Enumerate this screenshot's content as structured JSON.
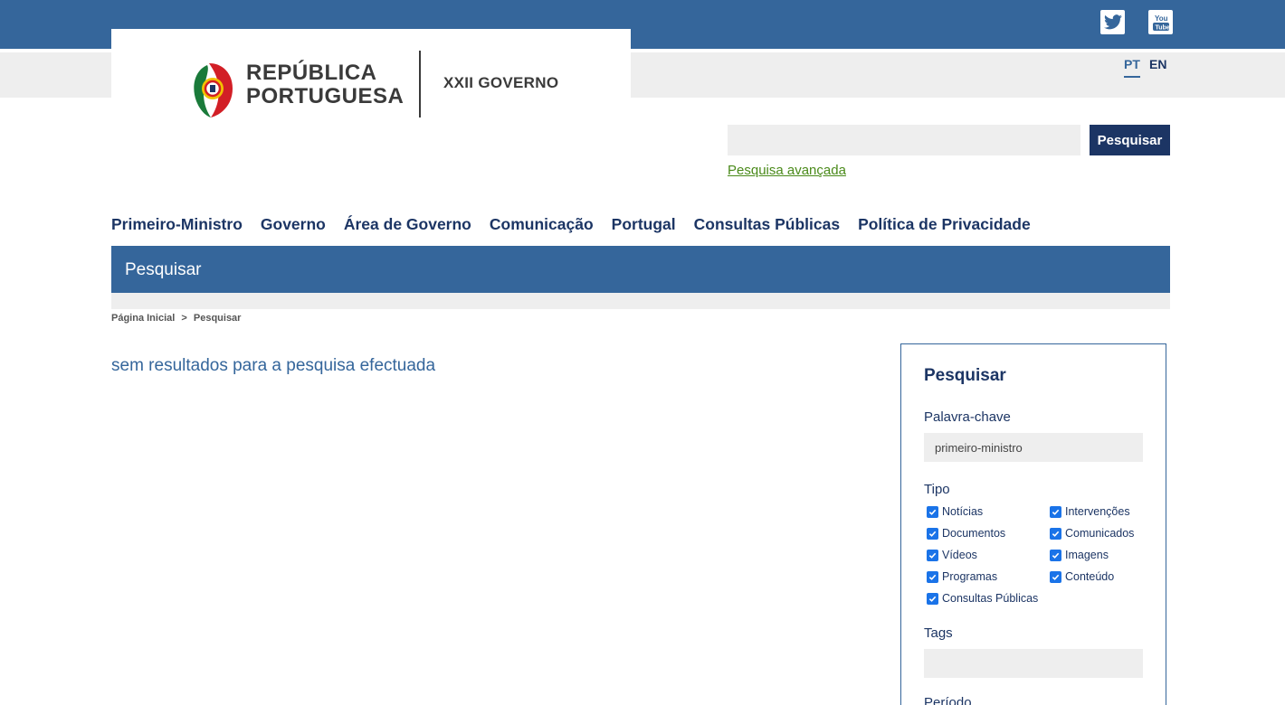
{
  "header": {
    "social": [
      "twitter-icon",
      "youtube-icon"
    ],
    "languages": [
      "PT",
      "EN"
    ],
    "logo_line1": "REPÚBLICA",
    "logo_line2": "PORTUGUESA",
    "logo_gov": "XXII GOVERNO"
  },
  "search": {
    "value": "",
    "button_label": "Pesquisar",
    "advanced_link": "Pesquisa avançada"
  },
  "nav": {
    "items": [
      "Primeiro-Ministro",
      "Governo",
      "Área de Governo",
      "Comunicação",
      "Portugal",
      "Consultas Públicas",
      "Política de Privacidade"
    ]
  },
  "page": {
    "title": "Pesquisar",
    "breadcrumb": [
      "Página Inicial",
      ">",
      "Pesquisar"
    ],
    "message": "sem resultados para a pesquisa efectuada"
  },
  "sidebar": {
    "title": "Pesquisar",
    "keyword_label": "Palavra-chave",
    "keyword_value": "primeiro-ministro",
    "type_label": "Tipo",
    "types": [
      {
        "label": "Notícias",
        "checked": true
      },
      {
        "label": "Intervenções",
        "checked": true
      },
      {
        "label": "Documentos",
        "checked": true
      },
      {
        "label": "Comunicados",
        "checked": true
      },
      {
        "label": "Vídeos",
        "checked": true
      },
      {
        "label": "Imagens",
        "checked": true
      },
      {
        "label": "Programas",
        "checked": true
      },
      {
        "label": "Conteúdo",
        "checked": true
      },
      {
        "label": "Consultas Públicas",
        "checked": true
      }
    ],
    "tags_label": "Tags",
    "tags_value": "",
    "period_label": "Período"
  },
  "colors": {
    "primary": "#35669b",
    "dark": "#1c3564",
    "link_green": "#4a8a1a",
    "light_gray": "#eeeeee"
  }
}
